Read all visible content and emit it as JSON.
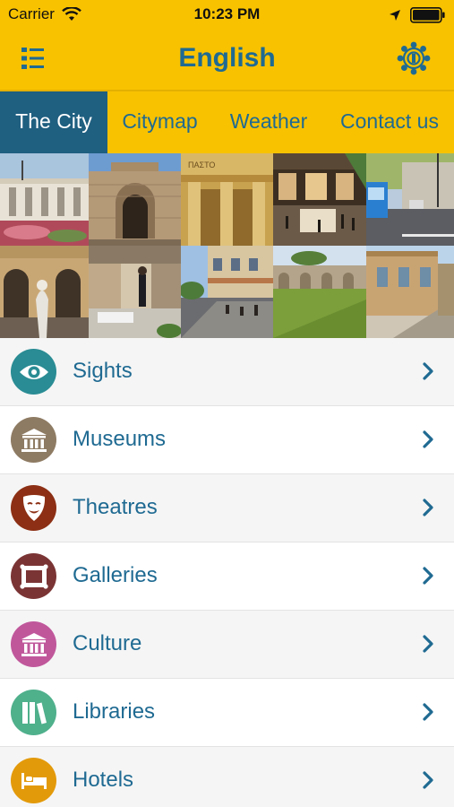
{
  "status_bar": {
    "carrier": "Carrier",
    "time": "10:23 PM"
  },
  "header": {
    "title": "English",
    "menu_icon": "list-menu-icon",
    "settings_icon": "city-seal-icon"
  },
  "tabs": [
    {
      "label": "The City",
      "active": true
    },
    {
      "label": "Citymap",
      "active": false
    },
    {
      "label": "Weather",
      "active": false
    },
    {
      "label": "Contact us",
      "active": false
    }
  ],
  "photos": [
    "town-hall-photo",
    "famagusta-gate-photo",
    "museum-columns-photo",
    "courtyard-photo",
    "street-bus-photo",
    "arcade-statue-photo",
    "pedestrian-street-photo",
    "cafe-street-photo",
    "aqueduct-park-photo",
    "old-building-photo"
  ],
  "list": [
    {
      "label": "Sights",
      "icon": "eye-icon",
      "color": "#2a8c94"
    },
    {
      "label": "Museums",
      "icon": "columns-building-icon",
      "color": "#8e7b63"
    },
    {
      "label": "Theatres",
      "icon": "theatre-mask-icon",
      "color": "#8c2f14"
    },
    {
      "label": "Galleries",
      "icon": "picture-frame-icon",
      "color": "#7b3434"
    },
    {
      "label": "Culture",
      "icon": "temple-icon",
      "color": "#c0579b"
    },
    {
      "label": "Libraries",
      "icon": "books-icon",
      "color": "#4fb08c"
    },
    {
      "label": "Hotels",
      "icon": "bed-icon",
      "color": "#e39a0a"
    }
  ],
  "colors": {
    "header_yellow": "#f8c201",
    "title_blue": "#1f6a92",
    "active_tab": "#1f5f80"
  }
}
